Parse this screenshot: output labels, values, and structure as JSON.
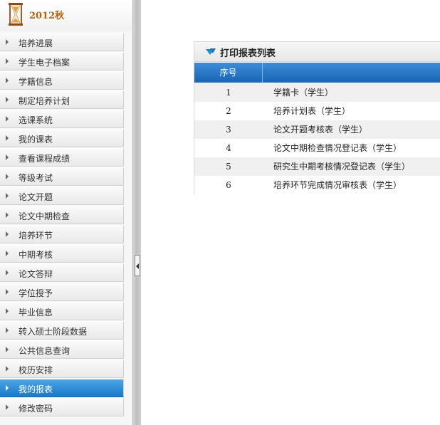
{
  "sidebar": {
    "term": "2012秋",
    "logo_icon": "hourglass-icon",
    "items": [
      {
        "label": "培养进展"
      },
      {
        "label": "学生电子档案"
      },
      {
        "label": "学籍信息"
      },
      {
        "label": "制定培养计划"
      },
      {
        "label": "选课系统"
      },
      {
        "label": "我的课表"
      },
      {
        "label": "查看课程成绩"
      },
      {
        "label": "等级考试"
      },
      {
        "label": "论文开题"
      },
      {
        "label": "论文中期检查"
      },
      {
        "label": "培养环节"
      },
      {
        "label": "中期考核"
      },
      {
        "label": "论文答辩"
      },
      {
        "label": "学位授予"
      },
      {
        "label": "毕业信息"
      },
      {
        "label": "转入硕士阶段数据"
      },
      {
        "label": "公共信息查询"
      },
      {
        "label": "校历安排"
      },
      {
        "label": "我的报表",
        "active": true
      },
      {
        "label": "修改密码"
      }
    ]
  },
  "panel": {
    "title": "打印报表列表",
    "columns": {
      "seq": "序号",
      "name": ""
    },
    "rows": [
      {
        "seq": "1",
        "name": "学籍卡（学生）"
      },
      {
        "seq": "2",
        "name": "培养计划表（学生）"
      },
      {
        "seq": "3",
        "name": "论文开题考核表（学生）"
      },
      {
        "seq": "4",
        "name": "论文中期检查情况登记表（学生）"
      },
      {
        "seq": "5",
        "name": "研究生中期考核情况登记表（学生）"
      },
      {
        "seq": "6",
        "name": "培养环节完成情况审核表（学生）"
      }
    ]
  },
  "colors": {
    "accent": "#1a78c8",
    "term_text": "#b06412",
    "header_blue": "#1864b3"
  }
}
